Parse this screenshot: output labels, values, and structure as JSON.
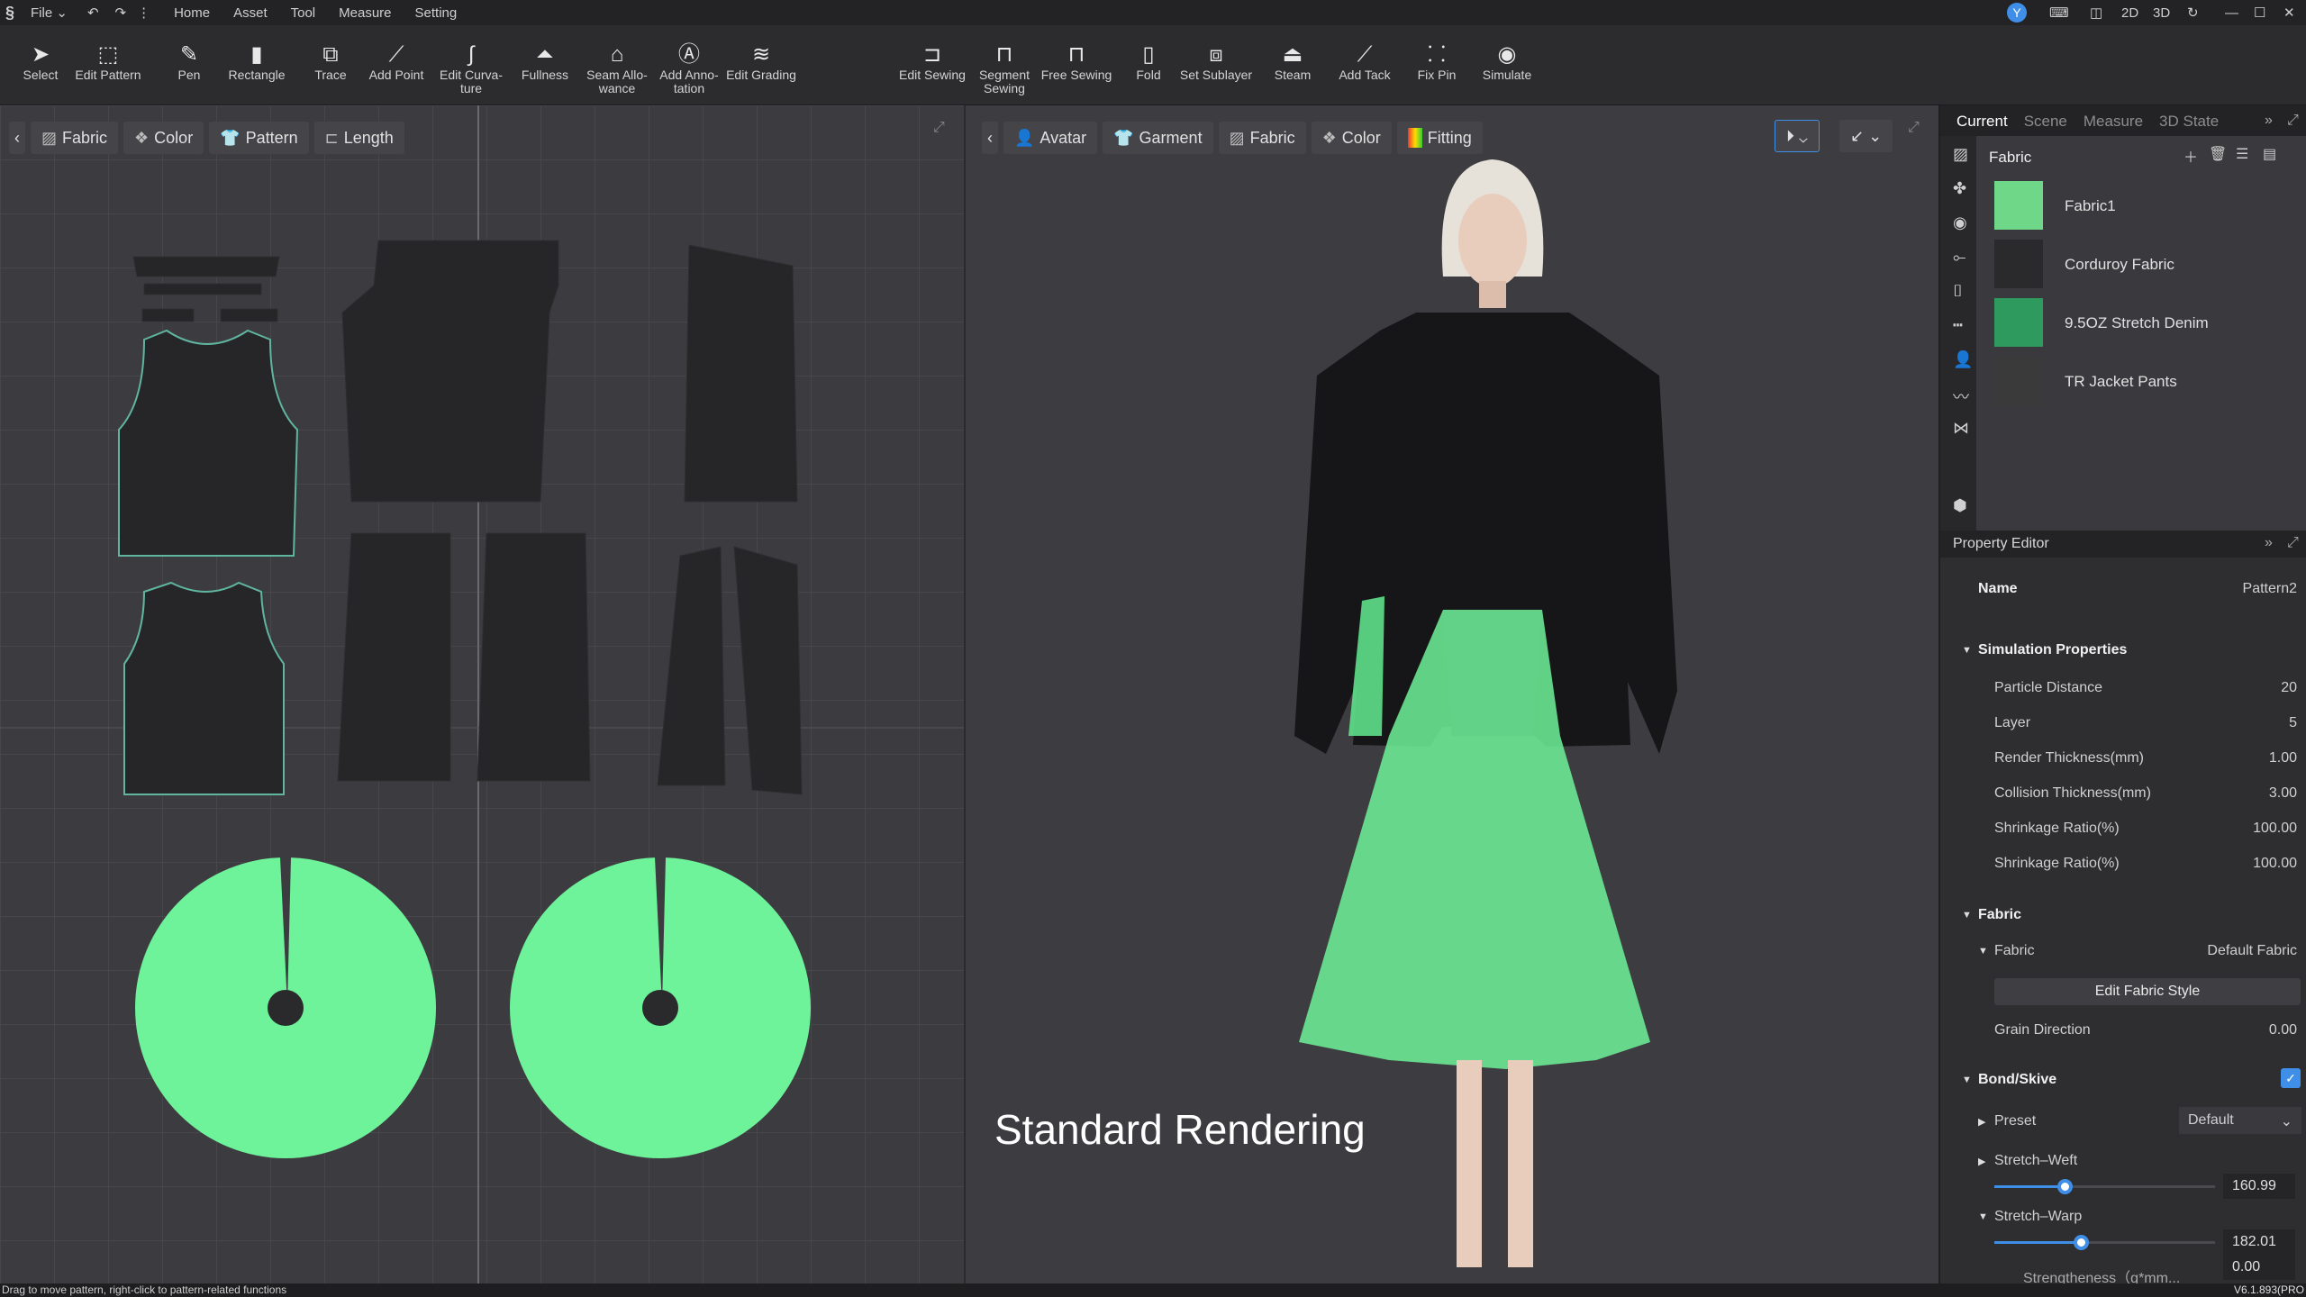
{
  "menubar": {
    "file": "File",
    "items": [
      "Home",
      "Asset",
      "Tool",
      "Measure",
      "Setting"
    ],
    "avatar": "Y",
    "view_2d": "2D",
    "view_3d": "3D"
  },
  "toolbar": {
    "left": [
      {
        "label": "Select",
        "icon": "cursor-icon"
      },
      {
        "label": "Edit Pattern",
        "icon": "edit-pattern-icon"
      },
      {
        "label": "Pen",
        "icon": "pen-icon"
      },
      {
        "label": "Rectangle",
        "icon": "rectangle-icon"
      },
      {
        "label": "Trace",
        "icon": "trace-icon"
      },
      {
        "label": "Add Point",
        "icon": "add-point-icon"
      },
      {
        "label": "Edit Curva-ture",
        "icon": "curve-icon"
      },
      {
        "label": "Fullness",
        "icon": "fullness-icon"
      },
      {
        "label": "Seam Allo-wance",
        "icon": "seam-allowance-icon"
      },
      {
        "label": "Add Anno-tation",
        "icon": "annotation-icon"
      },
      {
        "label": "Edit Grading",
        "icon": "grading-icon"
      }
    ],
    "right": [
      {
        "label": "Edit Sewing",
        "icon": "edit-sewing-icon"
      },
      {
        "label": "Segment Sewing",
        "icon": "segment-sewing-icon"
      },
      {
        "label": "Free Sewing",
        "icon": "free-sewing-icon"
      },
      {
        "label": "Fold",
        "icon": "fold-icon"
      },
      {
        "label": "Set Sublayer",
        "icon": "sublayer-icon"
      },
      {
        "label": "Steam",
        "icon": "steam-icon"
      },
      {
        "label": "Add Tack",
        "icon": "tack-icon"
      },
      {
        "label": "Fix Pin",
        "icon": "pin-icon"
      },
      {
        "label": "Simulate",
        "icon": "simulate-icon"
      }
    ]
  },
  "panel2d": {
    "chips": [
      "Fabric",
      "Color",
      "Pattern",
      "Length"
    ]
  },
  "panel3d": {
    "chips": [
      "Avatar",
      "Garment",
      "Fabric",
      "Color",
      "Fitting"
    ],
    "overlay": "Standard Rendering"
  },
  "right": {
    "tabs": [
      "Current",
      "Scene",
      "Measure",
      "3D State"
    ],
    "section": "Fabric",
    "fabrics": [
      {
        "name": "Fabric1",
        "color": "#6fd888"
      },
      {
        "name": "Corduroy Fabric",
        "color": "#2a2a2c"
      },
      {
        "name": "9.5OZ Stretch Denim",
        "color": "#2e9a5e"
      },
      {
        "name": "TR Jacket Pants",
        "color": "#3a3a3a"
      }
    ]
  },
  "property_editor": {
    "title": "Property Editor",
    "name_label": "Name",
    "name_value": "Pattern2",
    "simulation": {
      "title": "Simulation Properties",
      "rows": [
        {
          "label": "Particle Distance",
          "value": "20"
        },
        {
          "label": "Layer",
          "value": "5"
        },
        {
          "label": "Render Thickness(mm)",
          "value": "1.00"
        },
        {
          "label": "Collision Thickness(mm)",
          "value": "3.00"
        },
        {
          "label": "Shrinkage Ratio(%)",
          "value": "100.00"
        },
        {
          "label": "Shrinkage Ratio(%)",
          "value": "100.00"
        }
      ]
    },
    "fabric": {
      "title": "Fabric",
      "fabric_label": "Fabric",
      "fabric_value": "Default Fabric",
      "edit_button": "Edit  Fabric Style",
      "grain_label": "Grain Direction",
      "grain_value": "0.00"
    },
    "bond": {
      "title": "Bond/Skive",
      "checked": true,
      "preset_label": "Preset",
      "preset_value": "Default",
      "weft_label": "Stretch–Weft",
      "weft_value": "160.99",
      "weft_slider_pct": 32,
      "warp_label": "Stretch–Warp",
      "warp_value": "182.01",
      "warp_slider_pct": 39,
      "strength_label": "Strengtheness（g*mm...",
      "strength_value": "0.00"
    }
  },
  "version": "V6.1.893(PRO",
  "status": "Drag to move pattern, right-click to pattern-related functions",
  "colors": {
    "accent": "#3f8fe8",
    "mesh_green": "#6ef29a"
  }
}
